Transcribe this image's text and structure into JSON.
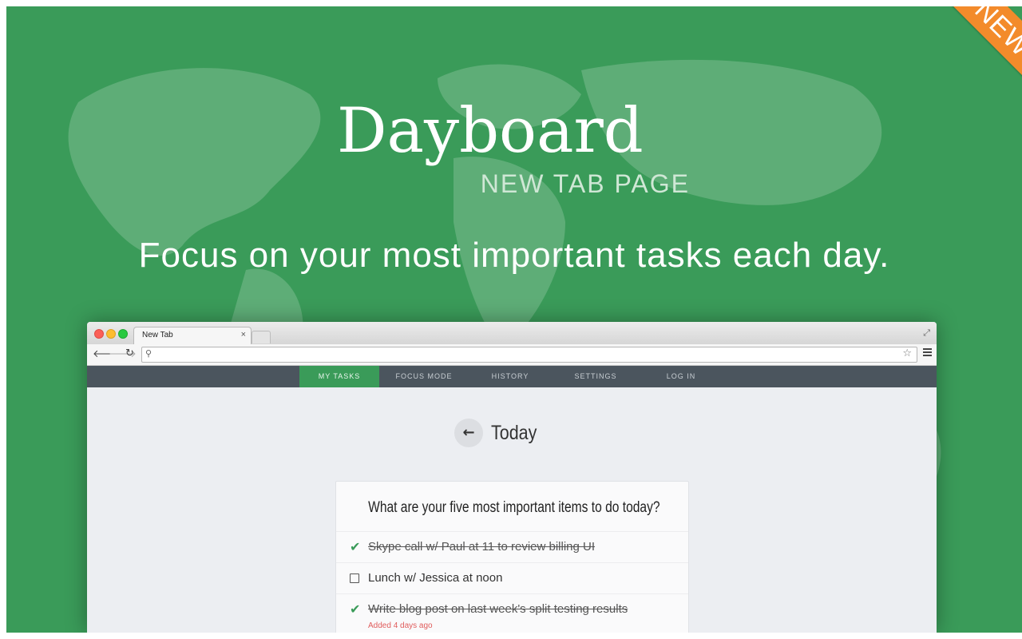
{
  "promo": {
    "logo": "Dayboard",
    "subtitle": "NEW TAB PAGE",
    "headline": "Focus on your most important tasks each day.",
    "ribbon": "NEW",
    "colors": {
      "background": "#3a9b59",
      "ribbon": "#f38b2b",
      "nav": "#4b555e"
    }
  },
  "browser": {
    "tab_title": "New Tab",
    "tab_close": "×",
    "icons": {
      "back": "arrow-left-icon",
      "forward": "arrow-right-icon",
      "reload": "reload-icon",
      "search": "search-icon",
      "bookmark": "star-icon",
      "menu": "hamburger-menu-icon",
      "fullscreen": "fullscreen-icon"
    }
  },
  "app": {
    "nav": [
      {
        "label": "MY TASKS",
        "active": true
      },
      {
        "label": "FOCUS MODE",
        "active": false
      },
      {
        "label": "HISTORY",
        "active": false
      },
      {
        "label": "SETTINGS",
        "active": false
      },
      {
        "label": "LOG IN",
        "active": false
      }
    ],
    "day_title": "Today",
    "question": "What are your five most important items to do today?",
    "tasks": [
      {
        "text": "Skype call w/ Paul at 11 to review billing UI",
        "done": true
      },
      {
        "text": "Lunch w/ Jessica at noon",
        "done": false
      },
      {
        "text": "Write blog post on last week's split testing results",
        "done": true,
        "meta": "Added 4 days ago"
      }
    ]
  }
}
